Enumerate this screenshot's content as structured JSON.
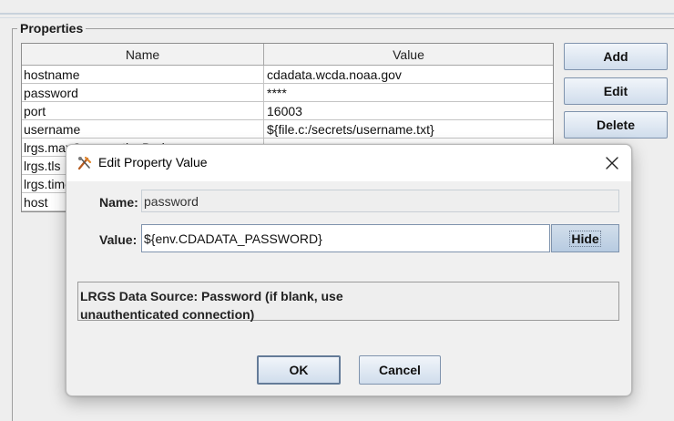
{
  "properties_group": {
    "title": "Properties",
    "columns": [
      "Name",
      "Value"
    ],
    "rows": [
      {
        "name": "hostname",
        "value": "cdadata.wcda.noaa.gov"
      },
      {
        "name": "password",
        "value": "****"
      },
      {
        "name": "port",
        "value": "16003"
      },
      {
        "name": "username",
        "value": "${file.c:/secrets/username.txt}"
      },
      {
        "name": "lrgs.maxConsecutiveBad",
        "value": ""
      },
      {
        "name": "lrgs.tls",
        "value": ""
      },
      {
        "name": "lrgs.timeout",
        "value": ""
      },
      {
        "name": "host",
        "value": ""
      }
    ]
  },
  "side_buttons": {
    "add": "Add",
    "edit": "Edit",
    "delete": "Delete"
  },
  "dialog": {
    "title": "Edit Property Value",
    "icon": "java-app-icon",
    "name_label": "Name:",
    "name_value": "password",
    "value_label": "Value:",
    "value_input": "${env.CDADATA_PASSWORD}",
    "hide_label": "Hide",
    "description_line1": "LRGS Data Source: Password (if blank, use",
    "description_line2": "unauthenticated connection)",
    "ok_label": "OK",
    "cancel_label": "Cancel"
  },
  "colors": {
    "button_border": "#7f93ad",
    "button_gradient_top": "#f1f5fa",
    "button_gradient_bottom": "#d0ddec",
    "hide_pressed": "#b7cbe1",
    "window_bg": "#eeeeee"
  }
}
